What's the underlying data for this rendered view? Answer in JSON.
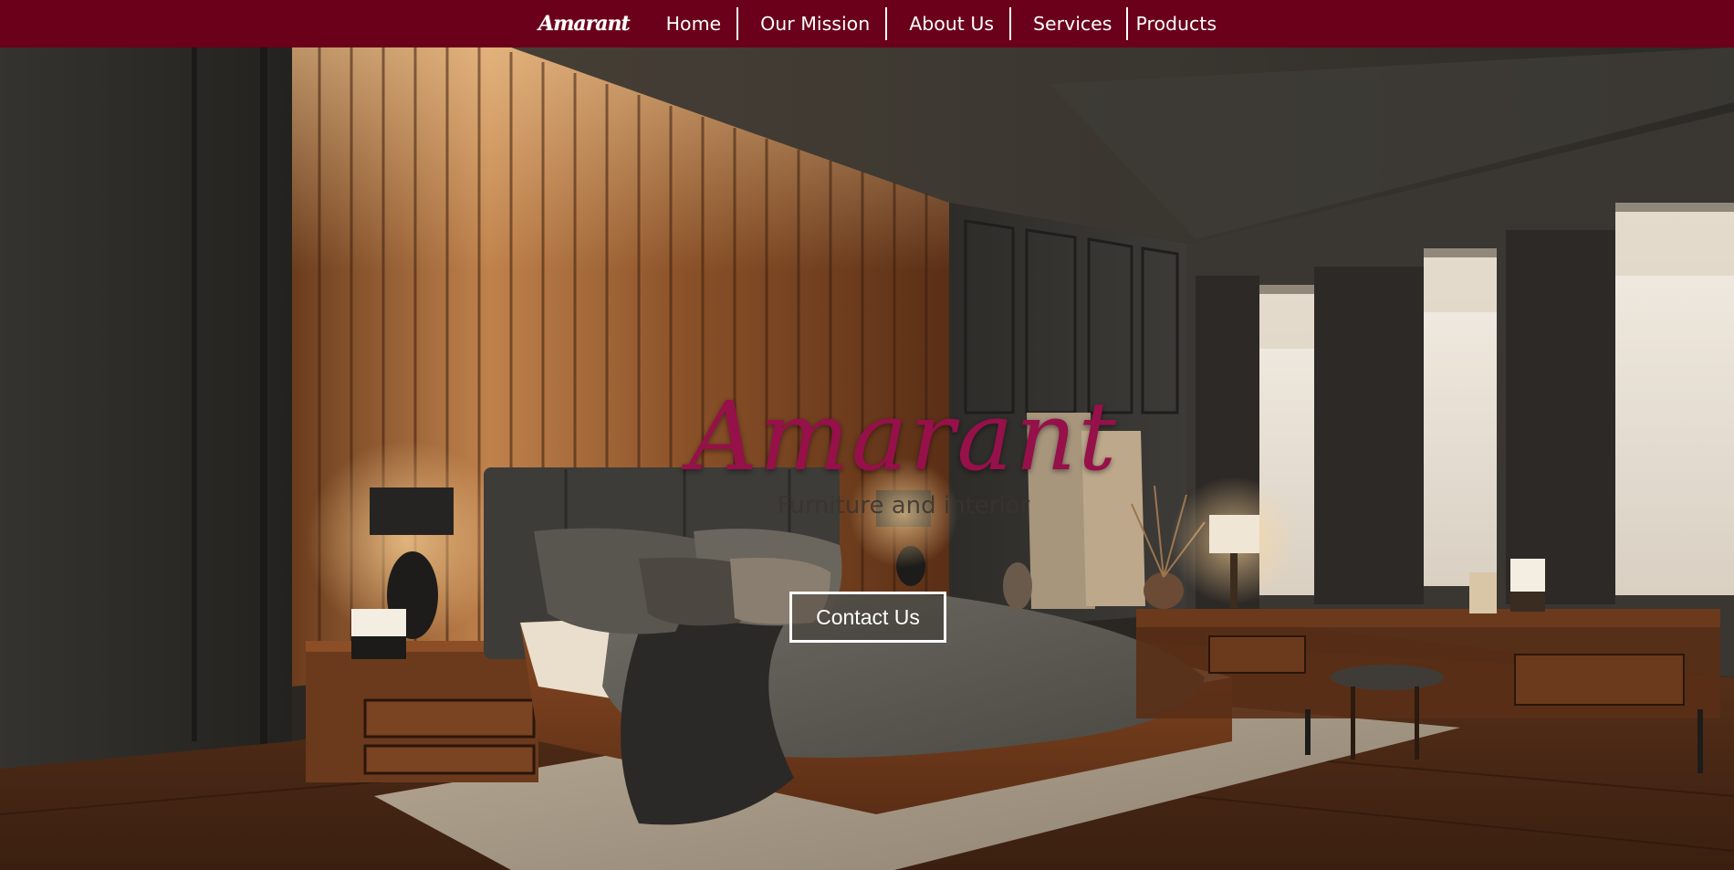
{
  "brand": {
    "logo_text": "Amarant",
    "color": "#6a0019"
  },
  "nav": {
    "items": [
      {
        "label": "Home"
      },
      {
        "label": "Our Mission"
      },
      {
        "label": "About Us"
      },
      {
        "label": "Services"
      },
      {
        "label": "Products"
      }
    ]
  },
  "hero": {
    "title": "Amarant",
    "subtitle": "Furniture and interior",
    "cta_label": "Contact Us",
    "title_color": "#96104a",
    "background_icon": "bedroom-photo"
  }
}
